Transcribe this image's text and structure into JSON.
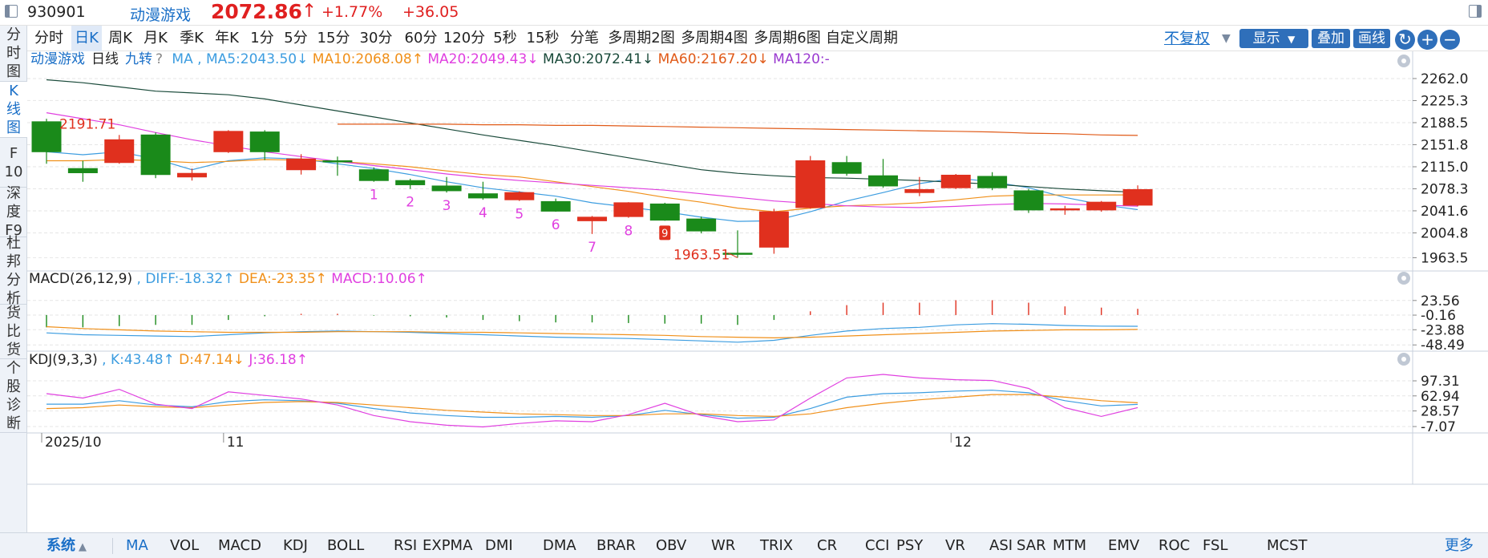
{
  "header": {
    "code": "930901",
    "name": "动漫游戏",
    "price": "2072.86",
    "change_pct": "+1.77%",
    "change_abs": "+36.05",
    "up_color": "#e02020",
    "link_color": "#1a6fc7"
  },
  "left_tabs": [
    {
      "label": "分时图"
    },
    {
      "label": "K线图",
      "active": true
    },
    {
      "label": "F10"
    },
    {
      "label": "深度F9"
    },
    {
      "label": "杜邦分析"
    },
    {
      "label": "货比货"
    },
    {
      "label": "个股诊断"
    }
  ],
  "period_tabs": [
    {
      "label": "分时"
    },
    {
      "label": "日K",
      "active": true
    },
    {
      "label": "周K"
    },
    {
      "label": "月K"
    },
    {
      "label": "季K"
    },
    {
      "label": "年K"
    },
    {
      "label": "1分"
    },
    {
      "label": "5分"
    },
    {
      "label": "15分"
    },
    {
      "label": "30分"
    },
    {
      "label": "60分"
    },
    {
      "label": "120分"
    },
    {
      "label": "5秒"
    },
    {
      "label": "15秒"
    },
    {
      "label": "分笔"
    },
    {
      "label": "多周期2图"
    },
    {
      "label": "多周期4图"
    },
    {
      "label": "多周期6图"
    },
    {
      "label": "自定义周期"
    }
  ],
  "toolbar": {
    "fuquan": "不复权",
    "show": "显示",
    "overlay": "叠加",
    "draw": "画线"
  },
  "indicator_tabs": [
    {
      "label": "系统",
      "active": true
    },
    {
      "label": "MA",
      "active": true
    },
    {
      "label": "VOL"
    },
    {
      "label": "MACD"
    },
    {
      "label": "KDJ"
    },
    {
      "label": "BOLL"
    },
    {
      "label": "RSI"
    },
    {
      "label": "EXPMA"
    },
    {
      "label": "DMI"
    },
    {
      "label": "DMA"
    },
    {
      "label": "BRAR"
    },
    {
      "label": "OBV"
    },
    {
      "label": "WR"
    },
    {
      "label": "TRIX"
    },
    {
      "label": "CR"
    },
    {
      "label": "CCI"
    },
    {
      "label": "PSY"
    },
    {
      "label": "VR"
    },
    {
      "label": "ASI"
    },
    {
      "label": "SAR"
    },
    {
      "label": "MTM"
    },
    {
      "label": "EMV"
    },
    {
      "label": "ROC"
    },
    {
      "label": "FSL"
    },
    {
      "label": "MCST"
    }
  ],
  "more_label": "更多",
  "chart_data": {
    "type": "candlestick",
    "title": "动漫游戏",
    "period_label": "日线",
    "jiuzhuan_label": "九转",
    "ma_legend": [
      {
        "label": "MA",
        "color": "#3d9de0"
      },
      {
        "label": "MA5:2043.50",
        "arrow": "down",
        "color": "#3d9de0"
      },
      {
        "label": "MA10:2068.08",
        "arrow": "up",
        "color": "#f0901a"
      },
      {
        "label": "MA20:2049.43",
        "arrow": "down",
        "color": "#e040e0"
      },
      {
        "label": "MA30:2072.41",
        "arrow": "down",
        "color": "#1a4a3a"
      },
      {
        "label": "MA60:2167.20",
        "arrow": "down",
        "color": "#e05a18"
      },
      {
        "label": "MA120:-",
        "color": "#9a3ad0"
      }
    ],
    "y_ticks": [
      "2262.0",
      "2225.3",
      "2188.5",
      "2151.8",
      "2115.0",
      "2078.3",
      "2041.6",
      "2004.8",
      "1963.5"
    ],
    "ylim": [
      1944,
      2286
    ],
    "x_tick_labels": [
      {
        "label": "2025/10",
        "index": 0
      },
      {
        "label": "11",
        "index": 5
      },
      {
        "label": "12",
        "index": 25
      }
    ],
    "up_color": "#e0301e",
    "down_color": "#1a8a1a",
    "candles": [
      {
        "open": 2190,
        "close": 2140,
        "high": 2195,
        "low": 2120
      },
      {
        "open": 2112,
        "close": 2105,
        "high": 2125,
        "low": 2090
      },
      {
        "open": 2122,
        "close": 2160,
        "high": 2168,
        "low": 2120
      },
      {
        "open": 2168,
        "close": 2102,
        "high": 2172,
        "low": 2096
      },
      {
        "open": 2098,
        "close": 2104,
        "high": 2112,
        "low": 2092
      },
      {
        "open": 2140,
        "close": 2174,
        "high": 2176,
        "low": 2138
      },
      {
        "open": 2173,
        "close": 2140,
        "high": 2176,
        "low": 2126
      },
      {
        "open": 2110,
        "close": 2128,
        "high": 2136,
        "low": 2102
      },
      {
        "open": 2125,
        "close": 2124,
        "high": 2132,
        "low": 2100
      },
      {
        "open": 2110,
        "close": 2092,
        "high": 2114,
        "low": 2090
      },
      {
        "open": 2092,
        "close": 2085,
        "high": 2095,
        "low": 2078
      },
      {
        "open": 2083,
        "close": 2075,
        "high": 2098,
        "low": 2072
      },
      {
        "open": 2070,
        "close": 2063,
        "high": 2090,
        "low": 2060
      },
      {
        "open": 2060,
        "close": 2072,
        "high": 2074,
        "low": 2058
      },
      {
        "open": 2057,
        "close": 2041,
        "high": 2062,
        "low": 2040
      },
      {
        "open": 2025,
        "close": 2031,
        "high": 2033,
        "low": 2003
      },
      {
        "open": 2032,
        "close": 2055,
        "high": 2056,
        "low": 2030
      },
      {
        "open": 2053,
        "close": 2026,
        "high": 2055,
        "low": 2025
      },
      {
        "open": 2028,
        "close": 2008,
        "high": 2032,
        "low": 2004
      },
      {
        "open": 1971,
        "close": 1969,
        "high": 2009,
        "low": 1963.51
      },
      {
        "open": 1981,
        "close": 2040,
        "high": 2045,
        "low": 1970
      },
      {
        "open": 2047,
        "close": 2125,
        "high": 2133,
        "low": 2045
      },
      {
        "open": 2122,
        "close": 2104,
        "high": 2133,
        "low": 2100
      },
      {
        "open": 2100,
        "close": 2083,
        "high": 2128,
        "low": 2080
      },
      {
        "open": 2072,
        "close": 2077,
        "high": 2098,
        "low": 2066
      },
      {
        "open": 2080,
        "close": 2101,
        "high": 2103,
        "low": 2078
      },
      {
        "open": 2099,
        "close": 2080,
        "high": 2106,
        "low": 2076
      },
      {
        "open": 2075,
        "close": 2043,
        "high": 2078,
        "low": 2038
      },
      {
        "open": 2044,
        "close": 2045,
        "high": 2050,
        "low": 2035
      },
      {
        "open": 2043,
        "close": 2056,
        "high": 2058,
        "low": 2040
      },
      {
        "open": 2051,
        "close": 2077,
        "high": 2084,
        "low": 2049
      }
    ],
    "ma_lines": {
      "MA5": [
        2140,
        2135,
        2140,
        2128,
        2110,
        2125,
        2130,
        2128,
        2120,
        2112,
        2102,
        2090,
        2080,
        2073,
        2066,
        2055,
        2048,
        2040,
        2031,
        2024,
        2025,
        2040,
        2058,
        2072,
        2087,
        2096,
        2090,
        2080,
        2064,
        2052,
        2043.5
      ],
      "MA10": [
        2125,
        2125,
        2127,
        2125,
        2122,
        2124,
        2127,
        2126,
        2124,
        2120,
        2115,
        2108,
        2102,
        2098,
        2090,
        2082,
        2074,
        2064,
        2056,
        2046,
        2040,
        2046,
        2050,
        2052,
        2055,
        2060,
        2066,
        2068,
        2068,
        2068,
        2068.08
      ],
      "MA20": [
        2205,
        2195,
        2185,
        2172,
        2160,
        2150,
        2140,
        2132,
        2124,
        2117,
        2110,
        2103,
        2097,
        2092,
        2088,
        2084,
        2080,
        2076,
        2070,
        2064,
        2058,
        2054,
        2050,
        2048,
        2047,
        2049,
        2052,
        2054,
        2053,
        2051,
        2049.43
      ],
      "MA30": [
        2260,
        2255,
        2248,
        2241,
        2238,
        2235,
        2228,
        2218,
        2208,
        2198,
        2188,
        2178,
        2168,
        2159,
        2150,
        2140,
        2130,
        2120,
        2110,
        2104,
        2100,
        2097,
        2096,
        2094,
        2092,
        2089,
        2086,
        2082,
        2078,
        2075,
        2072.41
      ],
      "MA60": [
        null,
        null,
        null,
        null,
        null,
        null,
        null,
        null,
        2186,
        2186,
        2186,
        2186,
        2185,
        2185,
        2184,
        2184,
        2183,
        2182,
        2181,
        2180,
        2179,
        2178,
        2177,
        2176,
        2175,
        2174,
        2173,
        2171,
        2170,
        2168,
        2167.2
      ]
    },
    "seq_labels": [
      {
        "label": "1",
        "index": 9
      },
      {
        "label": "2",
        "index": 10
      },
      {
        "label": "3",
        "index": 11
      },
      {
        "label": "4",
        "index": 12
      },
      {
        "label": "5",
        "index": 13
      },
      {
        "label": "6",
        "index": 14
      },
      {
        "label": "7",
        "index": 15
      },
      {
        "label": "8",
        "index": 16
      },
      {
        "label": "9",
        "index": 17
      }
    ],
    "annotations": [
      {
        "label": "2191.71",
        "index": 0,
        "value": 2191.71
      },
      {
        "label": "1963.51",
        "index": 19,
        "value": 1963.51
      }
    ],
    "macd": {
      "title": "MACD(26,12,9)",
      "legend": [
        {
          "label": "DIFF:-18.32",
          "arrow": "up",
          "color": "#3d9de0"
        },
        {
          "label": "DEA:-23.35",
          "arrow": "up",
          "color": "#f0901a"
        },
        {
          "label": "MACD:10.06",
          "arrow": "up",
          "color": "#e040e0"
        }
      ],
      "y_ticks": [
        "23.56",
        "-0.16",
        "-23.88",
        "-48.49"
      ],
      "ylim": [
        -56,
        35
      ],
      "diff": [
        -29,
        -32,
        -33,
        -34,
        -35,
        -32,
        -29,
        -27,
        -26,
        -27,
        -28,
        -30,
        -32,
        -34,
        -36,
        -37,
        -38,
        -40,
        -42,
        -44,
        -41,
        -33,
        -26,
        -22,
        -20,
        -16,
        -14,
        -15,
        -17,
        -18,
        -18.32
      ],
      "dea": [
        -19,
        -22,
        -24,
        -26,
        -27,
        -28,
        -28,
        -28,
        -27,
        -27,
        -27,
        -28,
        -28,
        -29,
        -30,
        -31,
        -32,
        -33,
        -35,
        -36,
        -37,
        -36,
        -34,
        -32,
        -30,
        -28,
        -26,
        -25,
        -24,
        -24,
        -23.35
      ],
      "hist": [
        -20,
        -20,
        -18,
        -16,
        -16,
        -8,
        -2,
        2,
        2,
        -1,
        -2,
        -4,
        -8,
        -10,
        -12,
        -12,
        -13,
        -14,
        -14,
        -16,
        -8,
        6,
        16,
        20,
        20,
        24,
        24,
        20,
        14,
        12,
        10.06
      ]
    },
    "kdj": {
      "title": "KDJ(9,3,3)",
      "legend": [
        {
          "label": "K:43.48",
          "arrow": "up",
          "color": "#3d9de0"
        },
        {
          "label": "D:47.14",
          "arrow": "down",
          "color": "#f0901a"
        },
        {
          "label": "J:36.18",
          "arrow": "up",
          "color": "#e040e0"
        }
      ],
      "y_ticks": [
        "97.31",
        "62.94",
        "28.57",
        "-7.07"
      ],
      "ylim": [
        -18,
        112
      ],
      "k": [
        44,
        44,
        52,
        42,
        38,
        50,
        54,
        52,
        46,
        34,
        24,
        18,
        14,
        14,
        16,
        14,
        18,
        30,
        20,
        12,
        14,
        34,
        60,
        68,
        70,
        74,
        76,
        70,
        52,
        40,
        43.48
      ],
      "d": [
        34,
        36,
        42,
        38,
        36,
        42,
        48,
        50,
        48,
        42,
        36,
        30,
        26,
        22,
        20,
        18,
        18,
        22,
        22,
        18,
        16,
        22,
        36,
        46,
        54,
        60,
        66,
        66,
        60,
        52,
        47.14
      ],
      "j": [
        68,
        58,
        78,
        44,
        34,
        72,
        64,
        56,
        42,
        18,
        4,
        -4,
        -8,
        0,
        6,
        4,
        20,
        46,
        18,
        4,
        8,
        58,
        104,
        112,
        104,
        100,
        98,
        80,
        36,
        16,
        36.18
      ]
    }
  }
}
